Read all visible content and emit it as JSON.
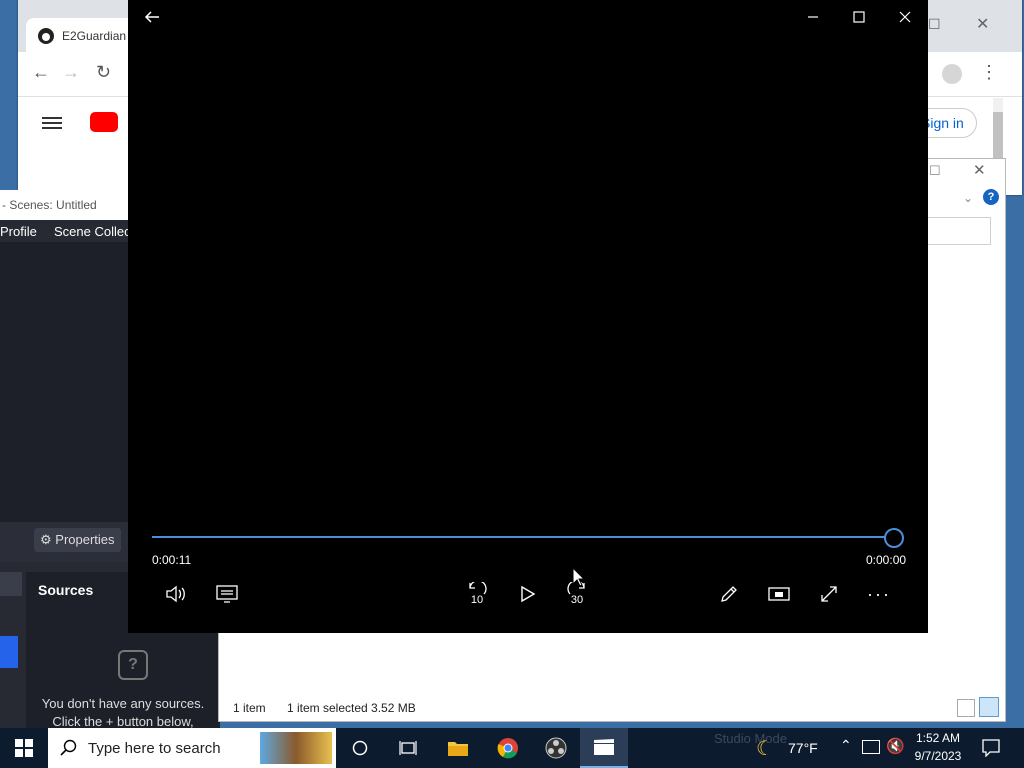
{
  "browser": {
    "tab_title": "E2Guardian",
    "signin_label": "Sign in"
  },
  "obs": {
    "window_title": "- Scenes: Untitled",
    "menu": [
      "Profile",
      "Scene Collec"
    ],
    "properties_label": "Properties",
    "sources_label": "Sources",
    "empty_line1": "You don't have any sources.",
    "empty_line2": "Click the + button below,"
  },
  "explorer": {
    "item_count": "1 item",
    "selected_info": "1 item selected  3.52 MB"
  },
  "player": {
    "elapsed": "0:00:11",
    "remaining": "0:00:00",
    "progress": 1.0,
    "skip_back_label": "10",
    "skip_forward_label": "30"
  },
  "taskbar": {
    "search_placeholder": "Type here to search",
    "temperature": "77°F",
    "time": "1:52 AM",
    "date": "9/7/2023",
    "studio_mode_label": "Studio Mode"
  },
  "colors": {
    "accent": "#4a90d9",
    "taskbar_bg": "#0d1b2e",
    "obs_bg": "#272a33"
  }
}
